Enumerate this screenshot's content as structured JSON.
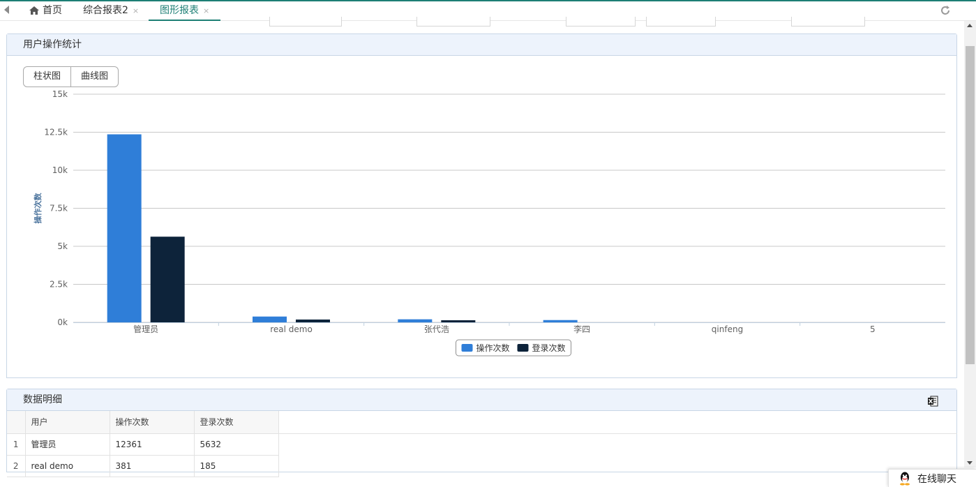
{
  "tabs": {
    "home": "首页",
    "tab2": "综合报表2",
    "tab3": "图形报表",
    "close": "×"
  },
  "panel_chart": {
    "title": "用户操作统计",
    "btn_bar": "柱状图",
    "btn_line": "曲线图"
  },
  "chart_data": {
    "type": "bar",
    "categories": [
      "管理员",
      "real demo",
      "张代浩",
      "李四",
      "qinfeng",
      "5"
    ],
    "series": [
      {
        "name": "操作次数",
        "color": "#2f7ed8",
        "values": [
          12361,
          381,
          200,
          150,
          0,
          0
        ]
      },
      {
        "name": "登录次数",
        "color": "#0d233a",
        "values": [
          5632,
          185,
          120,
          0,
          0,
          0
        ]
      }
    ],
    "ylabel": "操作次数",
    "ylim": [
      0,
      15000
    ],
    "yticks": [
      {
        "v": 0,
        "label": "0k"
      },
      {
        "v": 2500,
        "label": "2.5k"
      },
      {
        "v": 5000,
        "label": "5k"
      },
      {
        "v": 7500,
        "label": "7.5k"
      },
      {
        "v": 10000,
        "label": "10k"
      },
      {
        "v": 12500,
        "label": "12.5k"
      },
      {
        "v": 15000,
        "label": "15k"
      }
    ],
    "grid": true,
    "legend": "bottom-center"
  },
  "panel_table": {
    "title": "数据明细",
    "columns": [
      "用户",
      "操作次数",
      "登录次数"
    ],
    "rows": [
      {
        "idx": "1",
        "user": "管理员",
        "ops": "12361",
        "logins": "5632"
      },
      {
        "idx": "2",
        "user": "real demo",
        "ops": "381",
        "logins": "185"
      }
    ]
  },
  "chat": {
    "label": "在线聊天"
  }
}
